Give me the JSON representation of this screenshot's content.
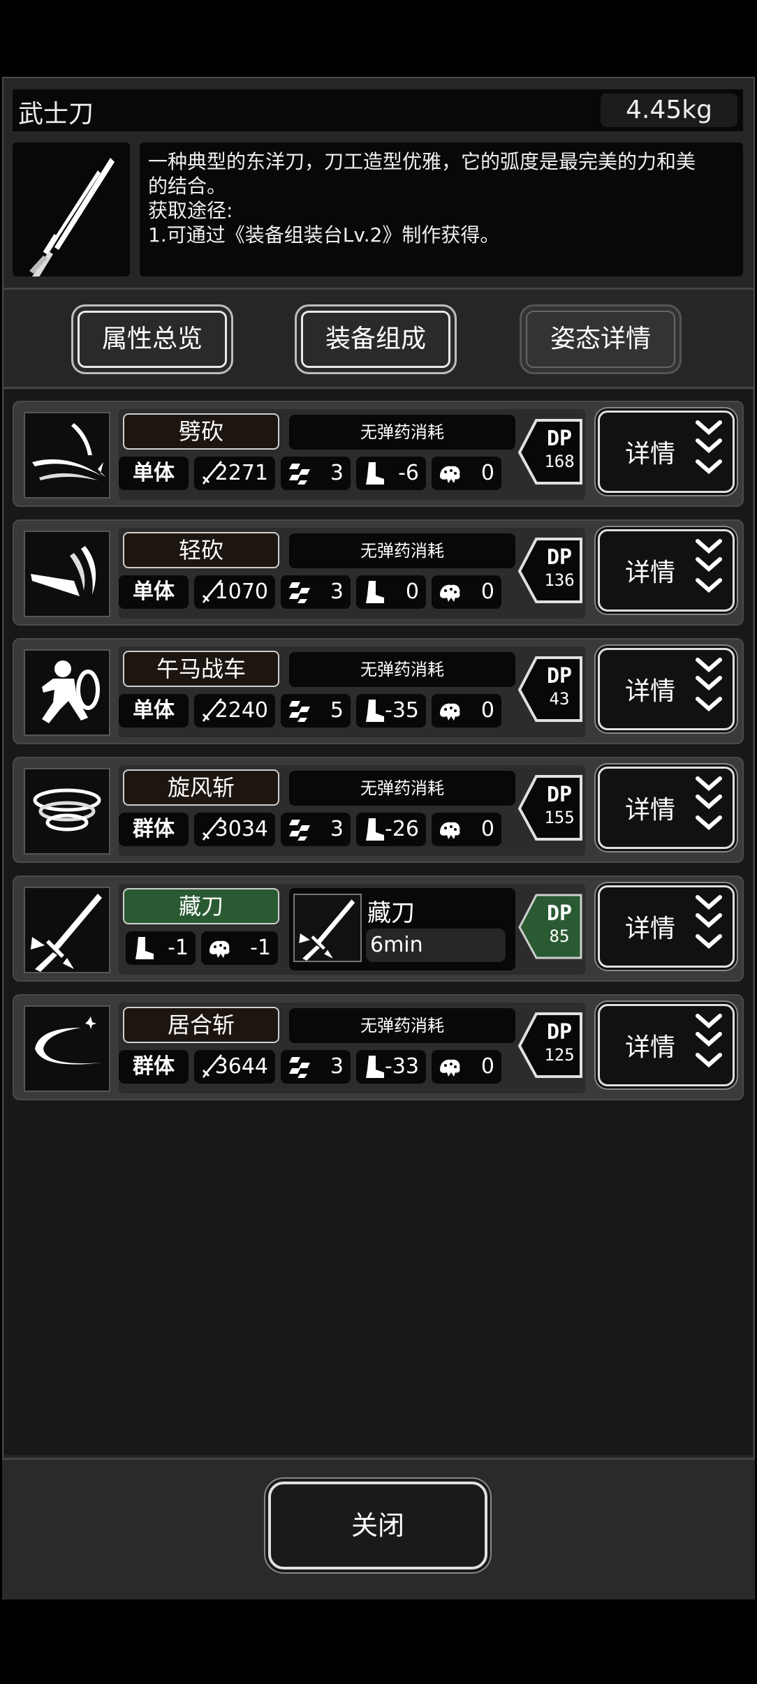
{
  "item": {
    "name": "武士刀",
    "weight": "4.45kg",
    "description_line1": "一种典型的东洋刀，刀工造型优雅，它的弧度是最完美的力和美",
    "description_line2": "的结合。",
    "source_label": "获取途径:",
    "source_1": "1.可通过《装备组装台Lv.2》制作获得。"
  },
  "tabs": [
    {
      "label": "属性总览"
    },
    {
      "label": "装备组成"
    },
    {
      "label": "姿态详情"
    }
  ],
  "skills": [
    {
      "name": "劈砍",
      "ammo": "无弹药消耗",
      "target": "单体",
      "damage": "2271",
      "ap": "3",
      "move": "-6",
      "stamina": "0",
      "dp_label": "DP",
      "dp": "168",
      "detail": "详情"
    },
    {
      "name": "轻砍",
      "ammo": "无弹药消耗",
      "target": "单体",
      "damage": "1070",
      "ap": "3",
      "move": "0",
      "stamina": "0",
      "dp_label": "DP",
      "dp": "136",
      "detail": "详情"
    },
    {
      "name": "午马战车",
      "ammo": "无弹药消耗",
      "target": "单体",
      "damage": "2240",
      "ap": "5",
      "move": "-35",
      "stamina": "0",
      "dp_label": "DP",
      "dp": "43",
      "detail": "详情"
    },
    {
      "name": "旋风斩",
      "ammo": "无弹药消耗",
      "target": "群体",
      "damage": "3034",
      "ap": "3",
      "move": "-26",
      "stamina": "0",
      "dp_label": "DP",
      "dp": "155",
      "detail": "详情"
    },
    {
      "name": "藏刀",
      "move": "-1",
      "stamina": "-1",
      "effect_name": "藏刀",
      "effect_time": "6min",
      "dp_label": "DP",
      "dp": "85",
      "detail": "详情"
    },
    {
      "name": "居合斩",
      "ammo": "无弹药消耗",
      "target": "群体",
      "damage": "3644",
      "ap": "3",
      "move": "-33",
      "stamina": "0",
      "dp_label": "DP",
      "dp": "125",
      "detail": "详情"
    }
  ],
  "close_label": "关闭",
  "colors": {
    "active_green": "#2a5a32",
    "panel": "#262626",
    "dark": "#080808"
  },
  "icons": [
    "katana-icon",
    "slash-icon",
    "light-slash-icon",
    "charge-icon",
    "whirlwind-icon",
    "hide-blade-icon",
    "iaido-icon",
    "sword-icon",
    "ap-icon",
    "boot-icon",
    "stamina-icon",
    "chevrons-down-icon"
  ]
}
